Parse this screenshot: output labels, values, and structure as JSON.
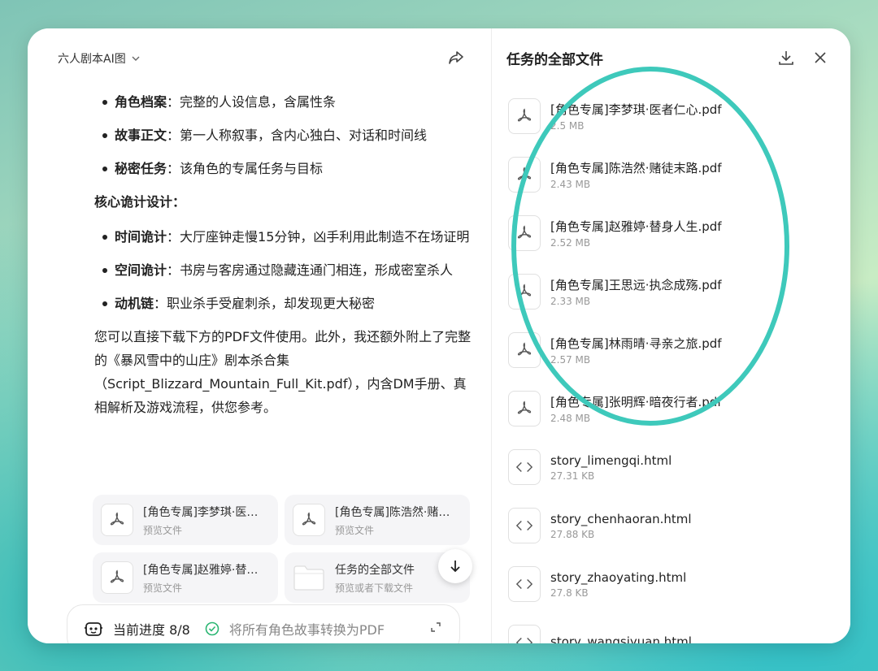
{
  "header": {
    "conversation_title": "六人剧本AI图"
  },
  "message": {
    "bullets_top": [
      {
        "key": "角色档案",
        "text": "：完整的人设信息，含属性条"
      },
      {
        "key": "故事正文",
        "text": "：第一人称叙事，含内心独白、对话和时间线"
      },
      {
        "key": "秘密任务",
        "text": "：该角色的专属任务与目标"
      }
    ],
    "section_title": "核心诡计设计：",
    "bullets_bottom": [
      {
        "key": "时间诡计",
        "text": "：大厅座钟走慢15分钟，凶手利用此制造不在场证明"
      },
      {
        "key": "空间诡计",
        "text": "：书房与客房通过隐藏连通门相连，形成密室杀人"
      },
      {
        "key": "动机链",
        "text": "：职业杀手受雇刺杀，却发现更大秘密"
      }
    ],
    "paragraph": "您可以直接下载下方的PDF文件使用。此外，我还额外附上了完整的《暴风雪中的山庄》剧本杀合集（Script_Blizzard_Mountain_Full_Kit.pdf），内含DM手册、真相解析及游戏流程，供您参考。"
  },
  "cards": [
    {
      "name": "[角色专属]李梦琪·医…",
      "sub": "预览文件"
    },
    {
      "name": "[角色专属]陈浩然·赌…",
      "sub": "预览文件"
    },
    {
      "name": "[角色专属]赵雅婷·替…",
      "sub": "预览文件"
    },
    {
      "name": "任务的全部文件",
      "sub": "预览或者下载文件"
    }
  ],
  "progress": {
    "label": "当前进度 8/8",
    "task": "将所有角色故事转换为PDF"
  },
  "files_panel": {
    "title": "任务的全部文件",
    "files": [
      {
        "name": "[角色专属]李梦琪·医者仁心.pdf",
        "size": "2.5 MB",
        "type": "pdf"
      },
      {
        "name": "[角色专属]陈浩然·赌徒末路.pdf",
        "size": "2.43 MB",
        "type": "pdf"
      },
      {
        "name": "[角色专属]赵雅婷·替身人生.pdf",
        "size": "2.52 MB",
        "type": "pdf"
      },
      {
        "name": "[角色专属]王思远·执念成殇.pdf",
        "size": "2.33 MB",
        "type": "pdf"
      },
      {
        "name": "[角色专属]林雨晴·寻亲之旅.pdf",
        "size": "2.57 MB",
        "type": "pdf"
      },
      {
        "name": "[角色专属]张明辉·暗夜行者.pdf",
        "size": "2.48 MB",
        "type": "pdf"
      },
      {
        "name": "story_limengqi.html",
        "size": "27.31 KB",
        "type": "html"
      },
      {
        "name": "story_chenhaoran.html",
        "size": "27.88 KB",
        "type": "html"
      },
      {
        "name": "story_zhaoyating.html",
        "size": "27.8 KB",
        "type": "html"
      },
      {
        "name": "story_wangsiyuan.html",
        "size": "",
        "type": "html"
      }
    ]
  },
  "colors": {
    "highlight": "#3ec9bb",
    "check": "#2bb673"
  }
}
